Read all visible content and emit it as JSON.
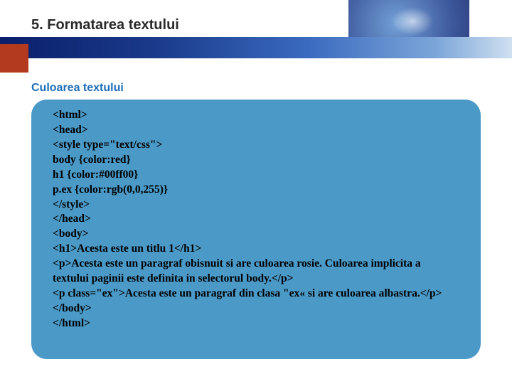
{
  "slide": {
    "title": "5. Formatarea textului",
    "subtitle": "Culoarea textului"
  },
  "code": {
    "l1": "<html>",
    "l2": "<head>",
    "l3": "<style type=\"text/css\">",
    "l4": "body {color:red}",
    "l5": "h1 {color:#00ff00}",
    "l6": "p.ex {color:rgb(0,0,255)}",
    "l7": "</style>",
    "l8": "</head>",
    "l9": "<body>",
    "l10": "<h1>Acesta este un titlu 1</h1>",
    "l11": "<p>Acesta este un paragraf obisnuit si are culoarea rosie. Culoarea implicita a textului paginii este definita in selectorul body.</p>",
    "l12": "<p class=\"ex\">Acesta este un paragraf din clasa \"ex« si are culoarea albastra.</p>",
    "l13": "</body>",
    "l14": "</html>"
  }
}
